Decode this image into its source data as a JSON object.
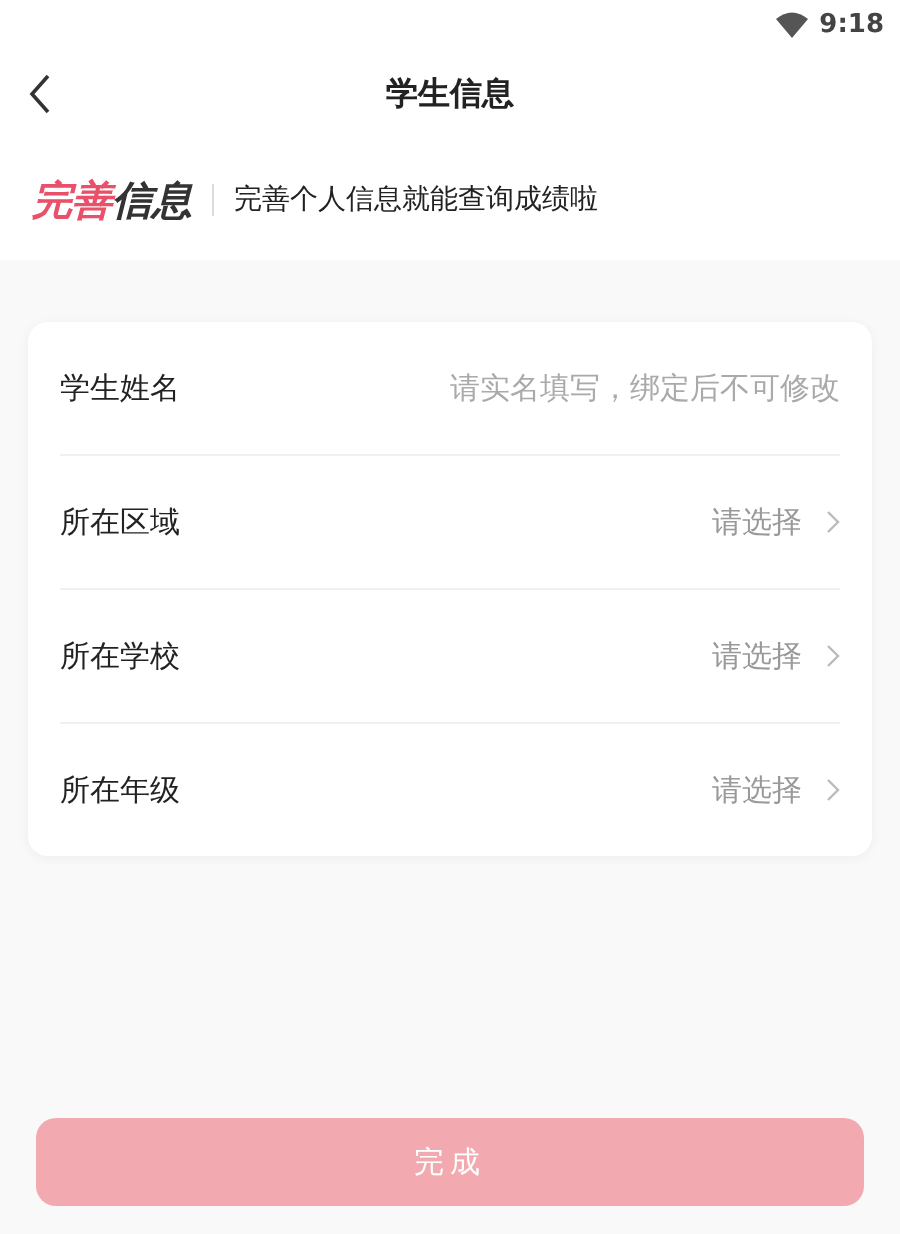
{
  "status_bar": {
    "time": "9:18"
  },
  "nav": {
    "title": "学生信息"
  },
  "banner": {
    "heading_accent": "完善",
    "heading_rest": "信息",
    "subtitle": "完善个人信息就能查询成绩啦"
  },
  "fields": [
    {
      "kind": "text",
      "label": "学生姓名",
      "placeholder": "请实名填写，绑定后不可修改"
    },
    {
      "kind": "select",
      "label": "所在区域",
      "placeholder": "请选择"
    },
    {
      "kind": "select",
      "label": "所在学校",
      "placeholder": "请选择"
    },
    {
      "kind": "select",
      "label": "所在年级",
      "placeholder": "请选择"
    }
  ],
  "submit": {
    "label": "完成",
    "disabled": true
  }
}
